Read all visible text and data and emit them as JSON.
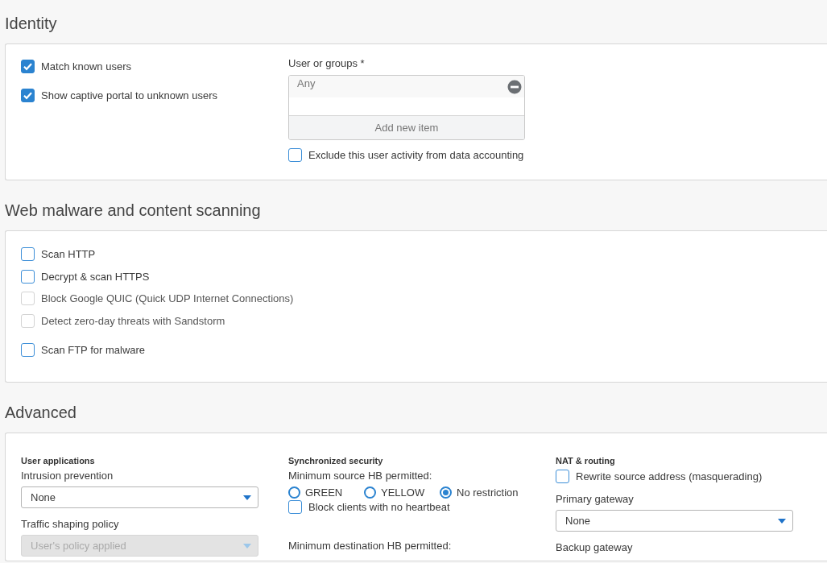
{
  "identity": {
    "title": "Identity",
    "options": [
      {
        "label": "Match known users",
        "checked": true
      },
      {
        "label": "Show captive portal to unknown users",
        "checked": true
      }
    ],
    "users_field": {
      "label": "User or groups *",
      "items": [
        "Any"
      ],
      "add_label": "Add new item"
    },
    "exclude": {
      "label": "Exclude this user activity from data accounting",
      "checked": false
    }
  },
  "scanning": {
    "title": "Web malware and content scanning",
    "groups": [
      [
        {
          "label": "Scan HTTP",
          "checked": false,
          "disabled": false
        },
        {
          "label": "Decrypt & scan HTTPS",
          "checked": false,
          "disabled": false
        },
        {
          "label": "Block Google QUIC (Quick UDP Internet Connections)",
          "checked": false,
          "disabled": true
        },
        {
          "label": "Detect zero-day threats with Sandstorm",
          "checked": false,
          "disabled": true
        }
      ],
      [
        {
          "label": "Scan FTP for malware",
          "checked": false,
          "disabled": false
        }
      ]
    ]
  },
  "advanced": {
    "title": "Advanced",
    "columns": [
      {
        "heading": "User applications",
        "items": [
          {
            "kind": "label",
            "text": "Intrusion prevention"
          },
          {
            "kind": "select",
            "value": "None",
            "disabled": false
          },
          {
            "kind": "label",
            "text": "Traffic shaping policy"
          },
          {
            "kind": "select",
            "value": "User's policy applied",
            "disabled": true
          }
        ]
      },
      {
        "heading": "Synchronized security",
        "items": [
          {
            "kind": "label",
            "text": "Minimum source HB permitted:"
          },
          {
            "kind": "radios",
            "options": [
              {
                "label": "GREEN",
                "selected": false
              },
              {
                "label": "YELLOW",
                "selected": false
              },
              {
                "label": "No restriction",
                "selected": true
              }
            ]
          },
          {
            "kind": "checkbox",
            "label": "Block clients with no heartbeat",
            "checked": false
          },
          {
            "kind": "spacer"
          },
          {
            "kind": "label",
            "text": "Minimum destination HB permitted:"
          }
        ]
      },
      {
        "heading": "NAT & routing",
        "items": [
          {
            "kind": "checkbox",
            "label": "Rewrite source address (masquerading)",
            "checked": false
          },
          {
            "kind": "label",
            "text": "Primary gateway"
          },
          {
            "kind": "select",
            "value": "None",
            "disabled": false
          },
          {
            "kind": "label",
            "text": "Backup gateway"
          }
        ]
      }
    ]
  }
}
